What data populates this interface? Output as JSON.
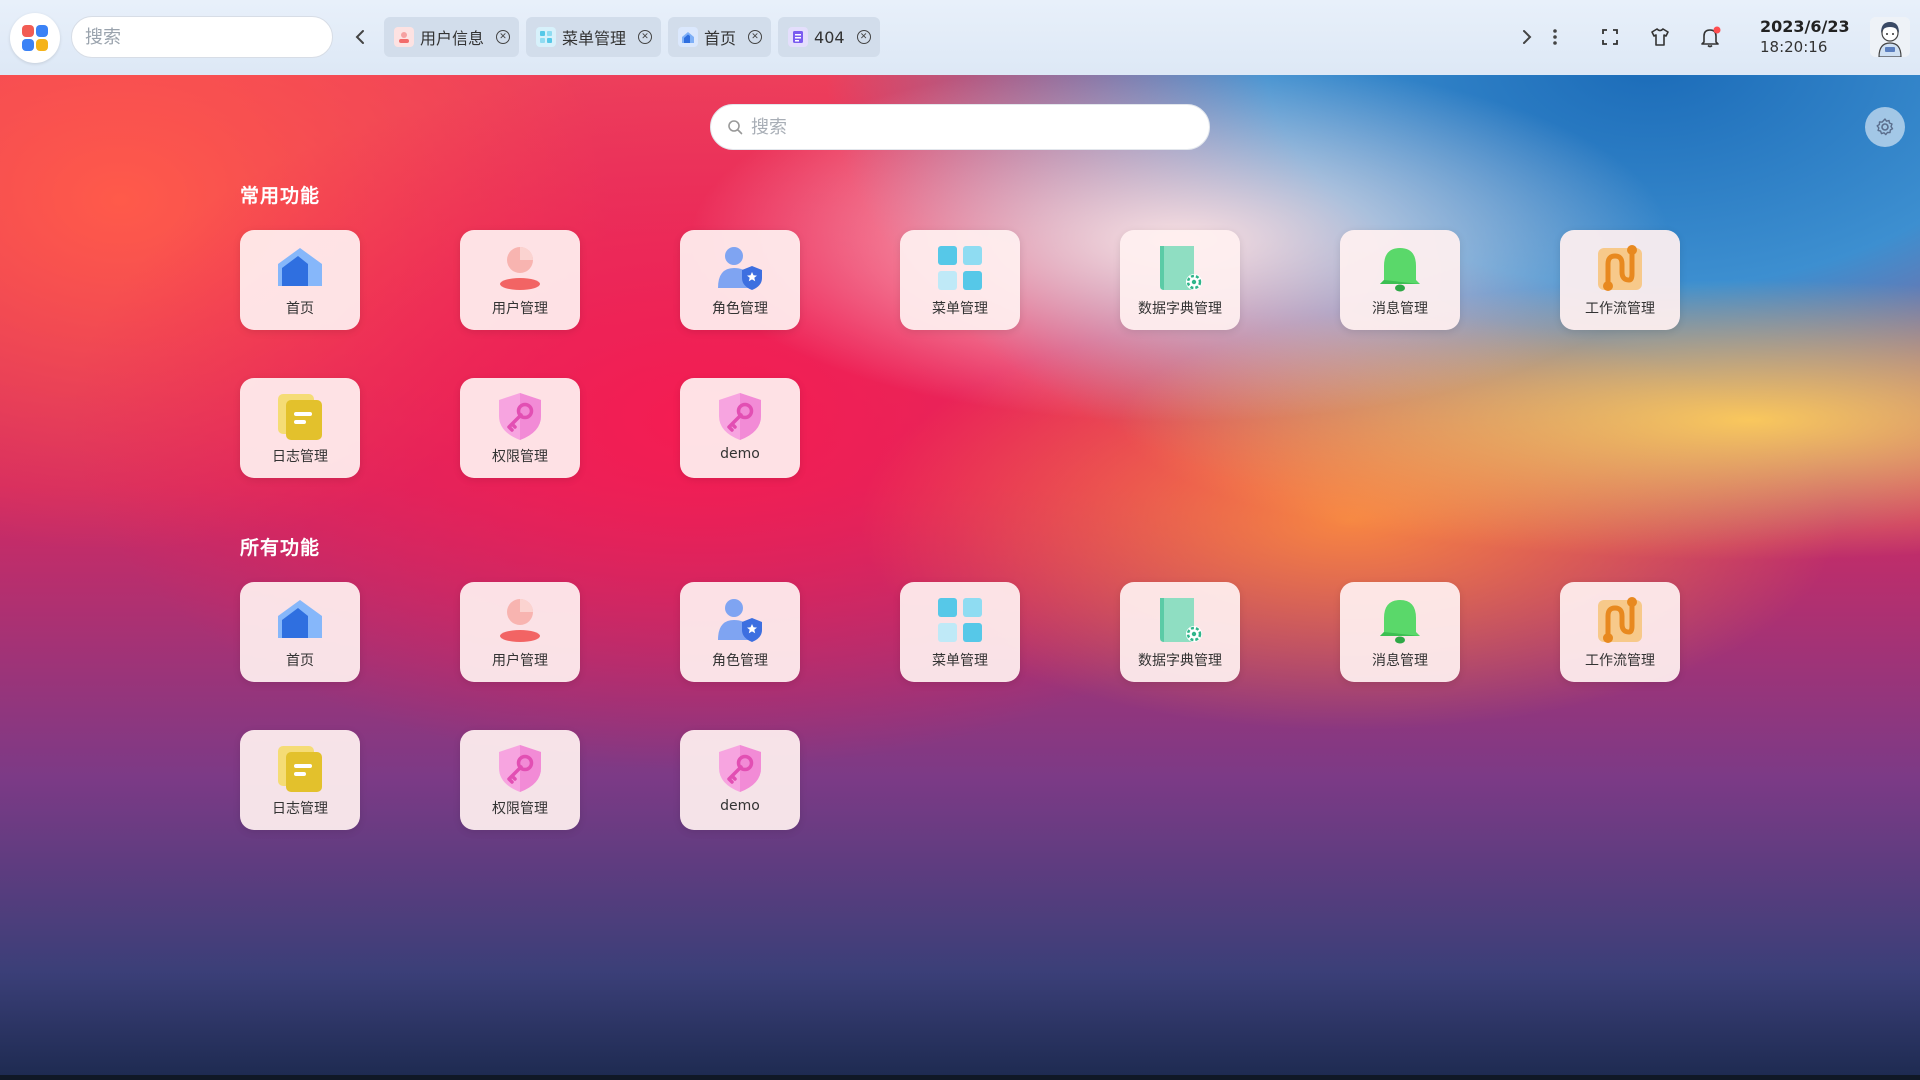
{
  "topbar": {
    "search_placeholder": "搜索",
    "tabs": [
      {
        "label": "用户信息",
        "icon": "user-icon"
      },
      {
        "label": "菜单管理",
        "icon": "grid-icon"
      },
      {
        "label": "首页",
        "icon": "home-icon"
      },
      {
        "label": "404",
        "icon": "page-icon"
      }
    ],
    "date": "2023/6/23",
    "time": "18:20:16"
  },
  "main": {
    "search_placeholder": "搜索"
  },
  "sections": {
    "common_title": "常用功能",
    "all_title": "所有功能"
  },
  "apps": [
    {
      "label": "首页",
      "icon": "home-icon"
    },
    {
      "label": "用户管理",
      "icon": "user-icon"
    },
    {
      "label": "角色管理",
      "icon": "role-icon"
    },
    {
      "label": "菜单管理",
      "icon": "grid-icon"
    },
    {
      "label": "数据字典管理",
      "icon": "dictionary-icon"
    },
    {
      "label": "消息管理",
      "icon": "bell-icon"
    },
    {
      "label": "工作流管理",
      "icon": "workflow-icon"
    },
    {
      "label": "日志管理",
      "icon": "log-icon"
    },
    {
      "label": "权限管理",
      "icon": "shield-key-icon"
    },
    {
      "label": "demo",
      "icon": "shield-key-icon"
    }
  ],
  "colors": {
    "home": "#3b82f6",
    "user": "#f87171",
    "role": "#6b8ff0",
    "grid": "#56c8e8",
    "dict": "#4fc3a1",
    "bell": "#4cd964",
    "workflow": "#f0a23c",
    "log": "#e8c23a",
    "shield": "#f49ad8",
    "notification_dot": "#ff4d4f"
  }
}
